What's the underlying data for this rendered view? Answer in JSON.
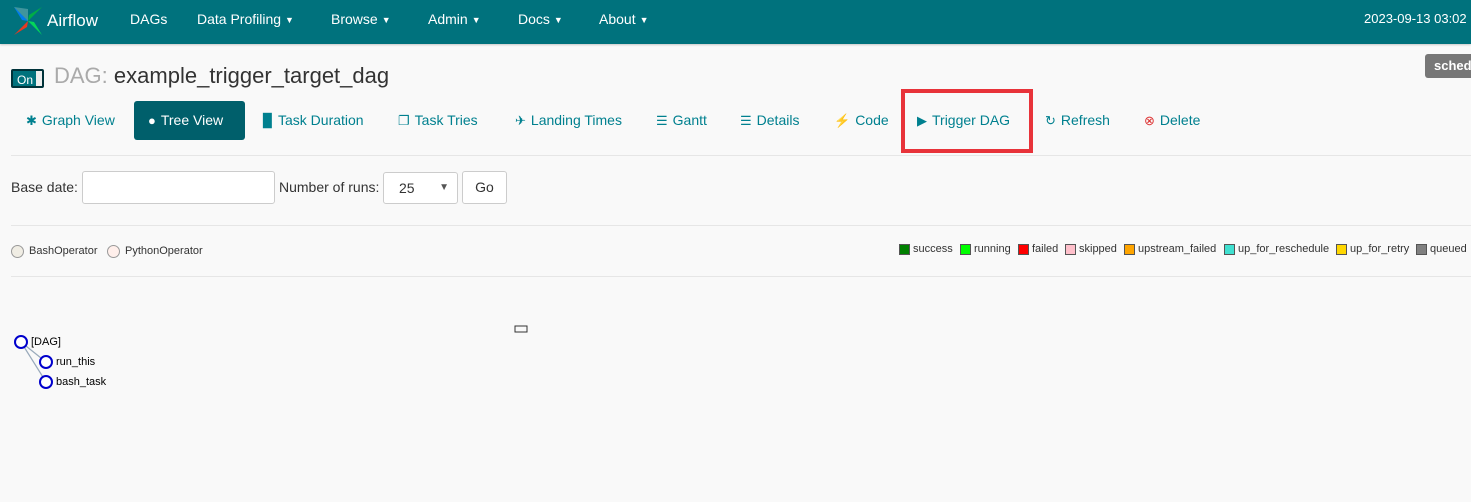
{
  "navbar": {
    "brand": "Airflow",
    "items": [
      {
        "label": "DAGs",
        "dropdown": false
      },
      {
        "label": "Data Profiling",
        "dropdown": true
      },
      {
        "label": "Browse",
        "dropdown": true
      },
      {
        "label": "Admin",
        "dropdown": true
      },
      {
        "label": "Docs",
        "dropdown": true
      },
      {
        "label": "About",
        "dropdown": true
      }
    ],
    "datetime": "2023-09-13 03:02"
  },
  "header": {
    "toggle_label": "On",
    "dag_prefix": "DAG:",
    "dag_name": "example_trigger_target_dag",
    "badge": "sched"
  },
  "tabs": [
    {
      "label": "Graph View",
      "icon": "asterisk-icon"
    },
    {
      "label": "Tree View",
      "icon": "tree-icon",
      "active": true
    },
    {
      "label": "Task Duration",
      "icon": "bar-chart-icon"
    },
    {
      "label": "Task Tries",
      "icon": "duplicate-icon"
    },
    {
      "label": "Landing Times",
      "icon": "plane-icon"
    },
    {
      "label": "Gantt",
      "icon": "align-left-icon"
    },
    {
      "label": "Details",
      "icon": "list-icon"
    },
    {
      "label": "Code",
      "icon": "flash-icon"
    },
    {
      "label": "Trigger DAG",
      "icon": "play-circle-icon"
    },
    {
      "label": "Refresh",
      "icon": "refresh-icon"
    },
    {
      "label": "Delete",
      "icon": "remove-circle-icon"
    }
  ],
  "form": {
    "base_date_label": "Base date:",
    "base_date_value": "",
    "num_runs_label": "Number of runs:",
    "num_runs_value": "25",
    "go_label": "Go"
  },
  "operators": [
    {
      "label": "BashOperator",
      "color": "#f0ede4"
    },
    {
      "label": "PythonOperator",
      "color": "#ffefeb"
    }
  ],
  "states": [
    {
      "label": "success",
      "color": "#008000"
    },
    {
      "label": "running",
      "color": "#00ff00"
    },
    {
      "label": "failed",
      "color": "#ff0000"
    },
    {
      "label": "skipped",
      "color": "#ffc0cb"
    },
    {
      "label": "upstream_failed",
      "color": "#ffa500"
    },
    {
      "label": "up_for_reschedule",
      "color": "#40e0d0"
    },
    {
      "label": "up_for_retry",
      "color": "#ffd700"
    },
    {
      "label": "queued",
      "color": "#808080"
    }
  ],
  "tree": [
    {
      "label": "[DAG]"
    },
    {
      "label": "run_this"
    },
    {
      "label": "bash_task"
    }
  ],
  "colors": {
    "navbar": "#00727d",
    "link": "#00808f",
    "active_tab": "#005f6b",
    "highlight": "#e8333a"
  }
}
